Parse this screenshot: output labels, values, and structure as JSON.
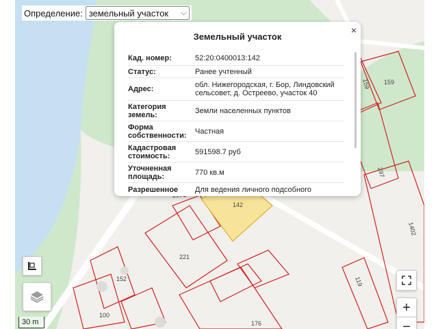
{
  "definition": {
    "label": "Определение:",
    "value": "земельный участок"
  },
  "popup": {
    "title": "Земельный участок",
    "close": "×",
    "rows": [
      {
        "label": "Кад. номер:",
        "value": "52:20:0400013:142"
      },
      {
        "label": "Статус:",
        "value": "Ранее учтенный"
      },
      {
        "label": "Адрес:",
        "value": "обл. Нижегородская, г. Бор, Линдовский сельсовет, д. Остреево, участок 40"
      },
      {
        "label": "Категория земель:",
        "value": "Земли населенных пунктов"
      },
      {
        "label": "Форма собственности:",
        "value": "Частная"
      },
      {
        "label": "Кадастровая стоимость:",
        "value": "591598.7 руб"
      },
      {
        "label": "Уточненная площадь:",
        "value": "770 кв.м"
      },
      {
        "label": "Разрешенное",
        "value": "Для ведения личного подсобного"
      }
    ]
  },
  "parcel_labels": {
    "p159a": "159",
    "p159b": "159",
    "p297": "297",
    "p1402": "1402",
    "p142": "142",
    "p221": "221",
    "p152": "152",
    "p100": "100",
    "p176": "176",
    "p119": "119",
    "p2974": "2974"
  },
  "controls": {
    "plus": "+",
    "minus": "−",
    "scale": "30 m"
  },
  "icons": [
    "legend-icon",
    "layers-icon",
    "fullscreen-icon",
    "zoom-in-icon",
    "zoom-out-icon",
    "close-icon",
    "chevron-down-icon"
  ],
  "colors": {
    "parcel_border": "#d02020",
    "selected_fill": "#f7e49a",
    "water": "#c6e0f2",
    "green": "#cfe8cc",
    "land": "#f1f0ec"
  }
}
